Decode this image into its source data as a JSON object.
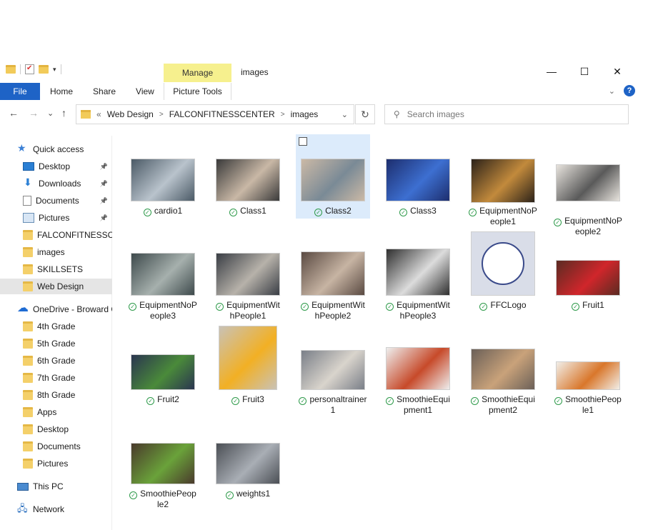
{
  "window": {
    "title": "images",
    "manage_tab": "Manage",
    "minimize": "—",
    "maximize": "☐",
    "close": "✕"
  },
  "ribbon": {
    "file": "File",
    "tabs": [
      "Home",
      "Share",
      "View"
    ],
    "picture_tools": "Picture Tools",
    "collapse": "⌄",
    "help": "?"
  },
  "nav": {
    "back": "←",
    "forward": "→",
    "recent": "⌄",
    "up": "↑",
    "address_prefix": "«",
    "breadcrumb": [
      "Web Design",
      "FALCONFITNESSCENTER",
      "images"
    ],
    "refresh": "↻",
    "search_placeholder": "Search images"
  },
  "sidebar": {
    "items": [
      {
        "label": "Quick access",
        "icon": "star-icon"
      },
      {
        "label": "Desktop",
        "icon": "desktop-icon",
        "pinned": true
      },
      {
        "label": "Downloads",
        "icon": "download-icon",
        "pinned": true
      },
      {
        "label": "Documents",
        "icon": "documents-icon",
        "pinned": true
      },
      {
        "label": "Pictures",
        "icon": "pictures-icon",
        "pinned": true
      },
      {
        "label": "FALCONFITNESSCENTER",
        "icon": "folder-icon"
      },
      {
        "label": "images",
        "icon": "folder-icon"
      },
      {
        "label": "SKILLSETS",
        "icon": "folder-icon"
      },
      {
        "label": "Web Design",
        "icon": "folder-icon",
        "selected": true
      },
      {
        "label": "OneDrive - Broward C",
        "icon": "onedrive-icon"
      },
      {
        "label": "4th Grade",
        "icon": "folder-icon"
      },
      {
        "label": "5th Grade",
        "icon": "folder-icon"
      },
      {
        "label": "6th Grade",
        "icon": "folder-icon"
      },
      {
        "label": "7th Grade",
        "icon": "folder-icon"
      },
      {
        "label": "8th Grade",
        "icon": "folder-icon"
      },
      {
        "label": "Apps",
        "icon": "folder-icon"
      },
      {
        "label": "Desktop",
        "icon": "folder-icon"
      },
      {
        "label": "Documents",
        "icon": "folder-icon"
      },
      {
        "label": "Pictures",
        "icon": "folder-icon"
      },
      {
        "label": "This PC",
        "icon": "this-pc-icon"
      },
      {
        "label": "Network",
        "icon": "network-icon"
      }
    ],
    "pin_glyph": "📌"
  },
  "files": [
    {
      "name": "cardio1",
      "color": "#4b5a66",
      "accent": "#b9c3cc"
    },
    {
      "name": "Class1",
      "color": "#3a3a3a",
      "accent": "#c9b8a6"
    },
    {
      "name": "Class2",
      "color": "#cbb9a6",
      "accent": "#7a8a96",
      "selected": true
    },
    {
      "name": "Class3",
      "color": "#1d2e6e",
      "accent": "#3d6fd1"
    },
    {
      "name": "EquipmentNoPeople1",
      "color": "#2c2219",
      "accent": "#c28a3c"
    },
    {
      "name": "EquipmentNoPeople2",
      "color": "#e7e3dd",
      "accent": "#5a5a5a"
    },
    {
      "name": "EquipmentNoPeople3",
      "color": "#3e4a4c",
      "accent": "#a6b0ad"
    },
    {
      "name": "EquipmentWithPeople1",
      "color": "#3a3e45",
      "accent": "#b7b2aa"
    },
    {
      "name": "EquipmentWithPeople2",
      "color": "#5a4a42",
      "accent": "#c7b4a3"
    },
    {
      "name": "EquipmentWithPeople3",
      "color": "#2f2f2f",
      "accent": "#dcdcdc"
    },
    {
      "name": "FFCLogo",
      "color": "#d9dde8",
      "accent": "#ffffff"
    },
    {
      "name": "Fruit1",
      "color": "#5b2b22",
      "accent": "#d0262b"
    },
    {
      "name": "Fruit2",
      "color": "#2a3550",
      "accent": "#4a8a3a"
    },
    {
      "name": "Fruit3",
      "color": "#c9c2b6",
      "accent": "#f2b024"
    },
    {
      "name": "personaltrainer1",
      "color": "#7a7f88",
      "accent": "#d9d4cc"
    },
    {
      "name": "SmoothieEquipment1",
      "color": "#eeeeee",
      "accent": "#c74a2a"
    },
    {
      "name": "SmoothieEquipment2",
      "color": "#6b6058",
      "accent": "#c9a27a"
    },
    {
      "name": "SmoothiePeople1",
      "color": "#f1eee8",
      "accent": "#d9772b"
    },
    {
      "name": "SmoothiePeople2",
      "color": "#4a3a2c",
      "accent": "#6aa23a"
    },
    {
      "name": "weights1",
      "color": "#4b4f55",
      "accent": "#a9aeb5"
    }
  ]
}
